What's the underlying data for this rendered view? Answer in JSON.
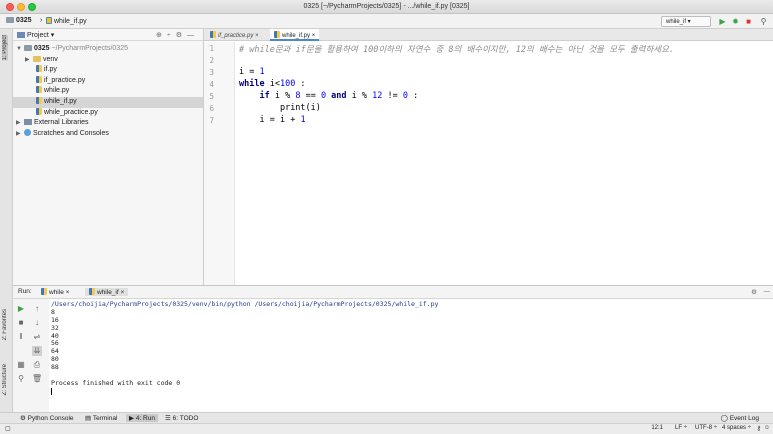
{
  "window": {
    "title": "0325 [~/PycharmProjects/0325] - .../while_if.py [0325]"
  },
  "navbar": {
    "project": "0325",
    "file": "while_if.py",
    "run_config": "while_if ▾"
  },
  "project_panel": {
    "header": "Project ▾",
    "items": [
      {
        "label": "0325",
        "suffix": "~/PycharmProjects/0325"
      },
      {
        "label": "venv"
      },
      {
        "label": "if.py"
      },
      {
        "label": "if_practice.py"
      },
      {
        "label": "while.py"
      },
      {
        "label": "while_if.py"
      },
      {
        "label": "while_practice.py"
      },
      {
        "label": "External Libraries"
      },
      {
        "label": "Scratches and Consoles"
      }
    ]
  },
  "editor": {
    "tabs": [
      "if_practice.py",
      "while_if.py"
    ],
    "line_numbers": [
      "1",
      "2",
      "3",
      "4",
      "5",
      "6",
      "7"
    ],
    "comment": "# while문과 if문을 활용하여 100이하의 자연수 중 8의 배수이지만, 12의 배수는 아닌 것을 모두 출력하세요.",
    "line3": {
      "a": "i = ",
      "b": "1"
    },
    "line4": {
      "kw": "while",
      "a": " i<",
      "b": "100",
      "c": " :"
    },
    "line5": {
      "kw": "if",
      "a": " i % ",
      "b": "8",
      "c": " == ",
      "d": "0",
      "kw2": " and",
      "e": " i % ",
      "f": "12",
      "g": " != ",
      "h": "0",
      "i": " :"
    },
    "line6": "print(i)",
    "line7": {
      "a": "i = i + ",
      "b": "1"
    }
  },
  "run_panel": {
    "label": "Run:",
    "tabs": [
      "while",
      "while_if"
    ],
    "console": [
      "/Users/choijia/PycharmProjects/0325/venv/bin/python /Users/choijia/PycharmProjects/0325/while_if.py",
      "8",
      "16",
      "32",
      "40",
      "56",
      "64",
      "80",
      "88",
      "",
      "Process finished with exit code 0"
    ]
  },
  "left_strip": {
    "project": "1: Project",
    "favorites": "2: Favorites",
    "structure": "Z: Structure"
  },
  "bottom_tabs": {
    "python_console": "Python Console",
    "terminal": "Terminal",
    "run": "4: Run",
    "todo": "6: TODO",
    "event_log": "Event Log"
  },
  "status": {
    "position": "12:1",
    "line_sep": "LF ÷",
    "encoding": "UTF-8 ÷",
    "indent": "4 spaces ÷"
  }
}
